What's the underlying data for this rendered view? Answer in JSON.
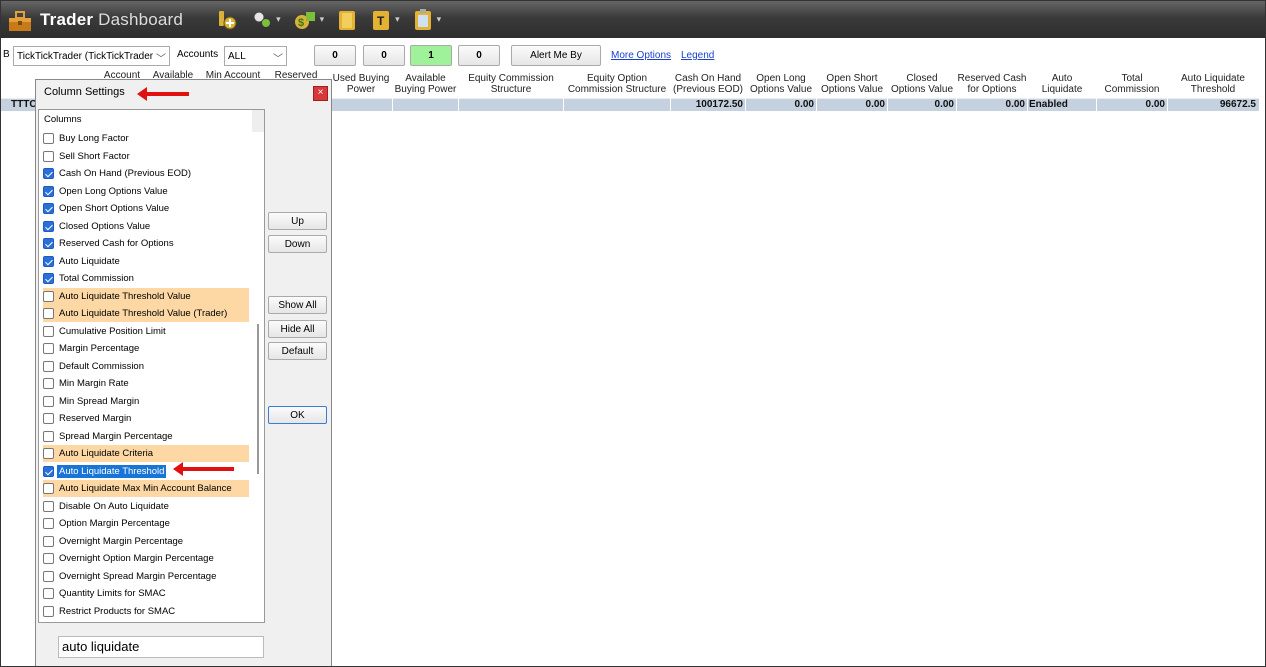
{
  "app": {
    "title_bold": "Trader",
    "title_rest": "Dashboard"
  },
  "toolbar": {
    "trader_label": "B",
    "trader_select": "TickTickTrader (TickTickTrader",
    "accounts_label": "Accounts",
    "accounts_select": "ALL",
    "counters": [
      "0",
      "0",
      "1",
      "0"
    ],
    "alert_button": "Alert Me By",
    "more_options": "More Options",
    "legend": "Legend"
  },
  "grid": {
    "headers": [
      {
        "l1": "Account",
        "l2": ""
      },
      {
        "l1": "Available",
        "l2": ""
      },
      {
        "l1": "Min Account",
        "l2": ""
      },
      {
        "l1": "Reserved",
        "l2": ""
      },
      {
        "l1": "Used Buying",
        "l2": "Power"
      },
      {
        "l1": "Available",
        "l2": "Buying Power"
      },
      {
        "l1": "Equity Commission",
        "l2": "Structure"
      },
      {
        "l1": "Equity Option",
        "l2": "Commission Structure"
      },
      {
        "l1": "Cash On Hand",
        "l2": "(Previous EOD)"
      },
      {
        "l1": "Open Long",
        "l2": "Options Value"
      },
      {
        "l1": "Open Short",
        "l2": "Options Value"
      },
      {
        "l1": "Closed",
        "l2": "Options Value"
      },
      {
        "l1": "Reserved Cash",
        "l2": "for Options"
      },
      {
        "l1": "Auto",
        "l2": "Liquidate"
      },
      {
        "l1": "Total",
        "l2": "Commission"
      },
      {
        "l1": "Auto Liquidate",
        "l2": "Threshold"
      }
    ],
    "row": {
      "account": "TTTC",
      "cash_on_hand": "100172.50",
      "open_long": "0.00",
      "open_short": "0.00",
      "closed": "0.00",
      "reserved_cash": "0.00",
      "auto_liquidate": "Enabled",
      "total_commission": "0.00",
      "threshold": "96672.5"
    }
  },
  "dialog": {
    "title": "Column Settings",
    "close": "×",
    "list_caption": "Columns",
    "search_value": "auto liquidate",
    "buttons": {
      "up": "Up",
      "down": "Down",
      "show_all": "Show All",
      "hide_all": "Hide All",
      "default": "Default",
      "ok": "OK"
    },
    "items": [
      {
        "label": "Buy Long Factor",
        "checked": false,
        "highlight": false
      },
      {
        "label": "Sell Short Factor",
        "checked": false,
        "highlight": false
      },
      {
        "label": "Cash On Hand (Previous EOD)",
        "checked": true,
        "highlight": false
      },
      {
        "label": "Open Long Options Value",
        "checked": true,
        "highlight": false
      },
      {
        "label": "Open Short Options Value",
        "checked": true,
        "highlight": false
      },
      {
        "label": "Closed Options Value",
        "checked": true,
        "highlight": false
      },
      {
        "label": "Reserved Cash for Options",
        "checked": true,
        "highlight": false
      },
      {
        "label": "Auto Liquidate",
        "checked": true,
        "highlight": false
      },
      {
        "label": "Total Commission",
        "checked": true,
        "highlight": false
      },
      {
        "label": "Auto Liquidate Threshold Value",
        "checked": false,
        "highlight": true
      },
      {
        "label": "Auto Liquidate Threshold Value (Trader)",
        "checked": false,
        "highlight": true
      },
      {
        "label": "Cumulative Position Limit",
        "checked": false,
        "highlight": false
      },
      {
        "label": "Margin Percentage",
        "checked": false,
        "highlight": false
      },
      {
        "label": "Default Commission",
        "checked": false,
        "highlight": false
      },
      {
        "label": "Min Margin Rate",
        "checked": false,
        "highlight": false
      },
      {
        "label": "Min Spread Margin",
        "checked": false,
        "highlight": false
      },
      {
        "label": "Reserved Margin",
        "checked": false,
        "highlight": false
      },
      {
        "label": "Spread Margin Percentage",
        "checked": false,
        "highlight": false
      },
      {
        "label": "Auto Liquidate Criteria",
        "checked": false,
        "highlight": true
      },
      {
        "label": "Auto Liquidate Threshold",
        "checked": true,
        "highlight": false,
        "selected": true
      },
      {
        "label": "Auto Liquidate Max Min Account Balance",
        "checked": false,
        "highlight": true
      },
      {
        "label": "Disable On Auto Liquidate",
        "checked": false,
        "highlight": false
      },
      {
        "label": "Option Margin Percentage",
        "checked": false,
        "highlight": false
      },
      {
        "label": "Overnight Margin Percentage",
        "checked": false,
        "highlight": false
      },
      {
        "label": "Overnight Option Margin Percentage",
        "checked": false,
        "highlight": false
      },
      {
        "label": "Overnight Spread Margin Percentage",
        "checked": false,
        "highlight": false
      },
      {
        "label": "Quantity Limits for SMAC",
        "checked": false,
        "highlight": false
      },
      {
        "label": "Restrict Products for SMAC",
        "checked": false,
        "highlight": false
      }
    ]
  },
  "colors": {
    "accent_red": "#e0110f",
    "selection_blue": "#1874d6",
    "highlight_orange": "#fdd8a5",
    "row_blue": "#c6d1df",
    "counter_green": "#9ff29a"
  }
}
